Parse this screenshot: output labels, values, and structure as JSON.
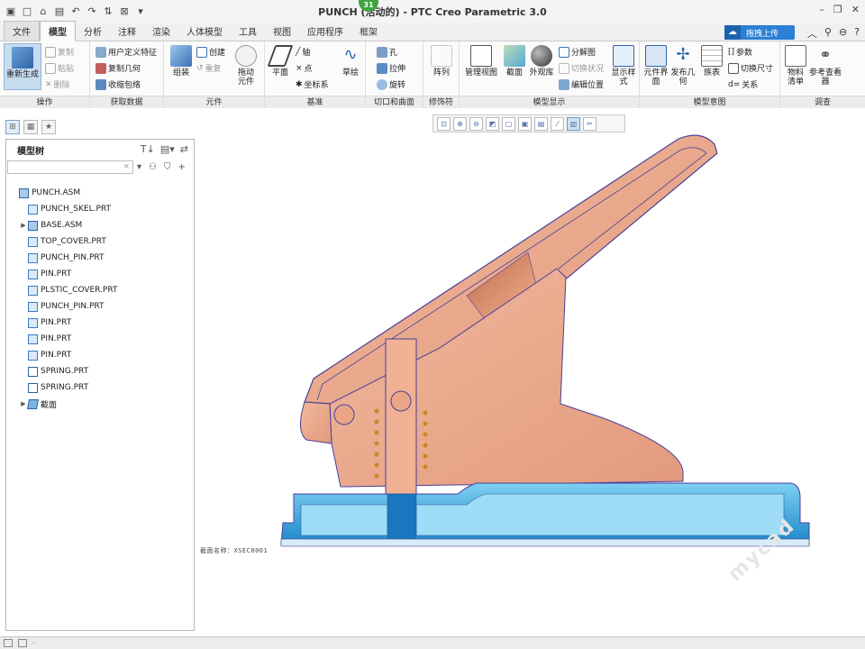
{
  "window": {
    "title": "PUNCH (活动的) - PTC Creo Parametric 3.0",
    "badge": "31",
    "qat_icons": [
      "new-icon",
      "open-icon",
      "save-icon",
      "undo-icon",
      "redo-icon",
      "regenerate-icon",
      "close-window-icon"
    ],
    "controls": [
      "minimize-icon",
      "restore-icon",
      "close-icon"
    ]
  },
  "menu_tabs": [
    {
      "label": "文件",
      "kind": "file"
    },
    {
      "label": "模型",
      "kind": "active"
    },
    {
      "label": "分析"
    },
    {
      "label": "注释"
    },
    {
      "label": "渲染"
    },
    {
      "label": "人体模型"
    },
    {
      "label": "工具"
    },
    {
      "label": "视图"
    },
    {
      "label": "应用程序"
    },
    {
      "label": "框架"
    }
  ],
  "upload_button": "拖拽上传",
  "ribbon": {
    "groups": {
      "ops": "操作",
      "data": "获取数据",
      "component": "元件",
      "datum": "基准",
      "cut": "切口和曲面",
      "modifier": "修饰符",
      "display": "模型显示",
      "intent": "模型意图",
      "investigate": "调查"
    },
    "ops": {
      "regenerate": "重新生成",
      "copy": "复制",
      "paste": "粘贴",
      "delete": "删除"
    },
    "data": {
      "udf": "用户定义特征",
      "copy_geom": "复制几何",
      "shrinkwrap": "收缩包络"
    },
    "component": {
      "assemble": "组装",
      "create": "创建",
      "repeat": "重复",
      "drag": "拖动元件"
    },
    "datum": {
      "plane": "平面",
      "axis": "轴",
      "point": "点",
      "csys": "坐标系",
      "sketch": "草绘"
    },
    "cut": {
      "hole": "孔",
      "extrude": "拉伸",
      "revolve": "旋转"
    },
    "modifier": {
      "pattern": "阵列"
    },
    "display": {
      "manage_views": "管理视图",
      "section": "截面",
      "appearance": "外观库",
      "explode": "分解图",
      "toggle_status": "切换状况",
      "edit_position": "编辑位置",
      "display_style": "显示样式"
    },
    "intent": {
      "component_interface": "元件界面",
      "publish_geom": "发布几何",
      "family_table": "族表",
      "parameters": "参数",
      "switch_dims": "切换尺寸",
      "relations": "关系"
    },
    "investigate": {
      "bom": "物料清单",
      "ref_viewer": "参考查看器"
    }
  },
  "model_tree": {
    "title": "模型树",
    "search_placeholder": "",
    "items": [
      {
        "label": "PUNCH.ASM",
        "type": "asm",
        "expand": "",
        "indent": 0
      },
      {
        "label": "PUNCH_SKEL.PRT",
        "type": "prt",
        "expand": "",
        "indent": 1
      },
      {
        "label": "BASE.ASM",
        "type": "asm",
        "expand": "▶",
        "indent": 1
      },
      {
        "label": "TOP_COVER.PRT",
        "type": "prt",
        "expand": "",
        "indent": 1
      },
      {
        "label": "PUNCH_PIN.PRT",
        "type": "prt",
        "expand": "",
        "indent": 1
      },
      {
        "label": "PIN.PRT",
        "type": "prt",
        "expand": "",
        "indent": 1
      },
      {
        "label": "PLSTIC_COVER.PRT",
        "type": "prt",
        "expand": "",
        "indent": 1
      },
      {
        "label": "PUNCH_PIN.PRT",
        "type": "prt",
        "expand": "",
        "indent": 1
      },
      {
        "label": "PIN.PRT",
        "type": "prt",
        "expand": "",
        "indent": 1
      },
      {
        "label": "PIN.PRT",
        "type": "prt",
        "expand": "",
        "indent": 1
      },
      {
        "label": "PIN.PRT",
        "type": "prt",
        "expand": "",
        "indent": 1
      },
      {
        "label": "SPRING.PRT",
        "type": "spr",
        "expand": "",
        "indent": 1
      },
      {
        "label": "SPRING.PRT",
        "type": "spr",
        "expand": "",
        "indent": 1
      },
      {
        "label": "截面",
        "type": "sec",
        "expand": "▶",
        "indent": 1
      }
    ]
  },
  "graphics": {
    "section_label": "截面名称：XSEC0001",
    "watermark": "mycad",
    "colors": {
      "lever": "#e8a386",
      "lever_edge": "#4a3f9c",
      "base": "#1f8fd0",
      "base_light": "#6cc3ee"
    }
  },
  "status": {
    "text": "·"
  }
}
